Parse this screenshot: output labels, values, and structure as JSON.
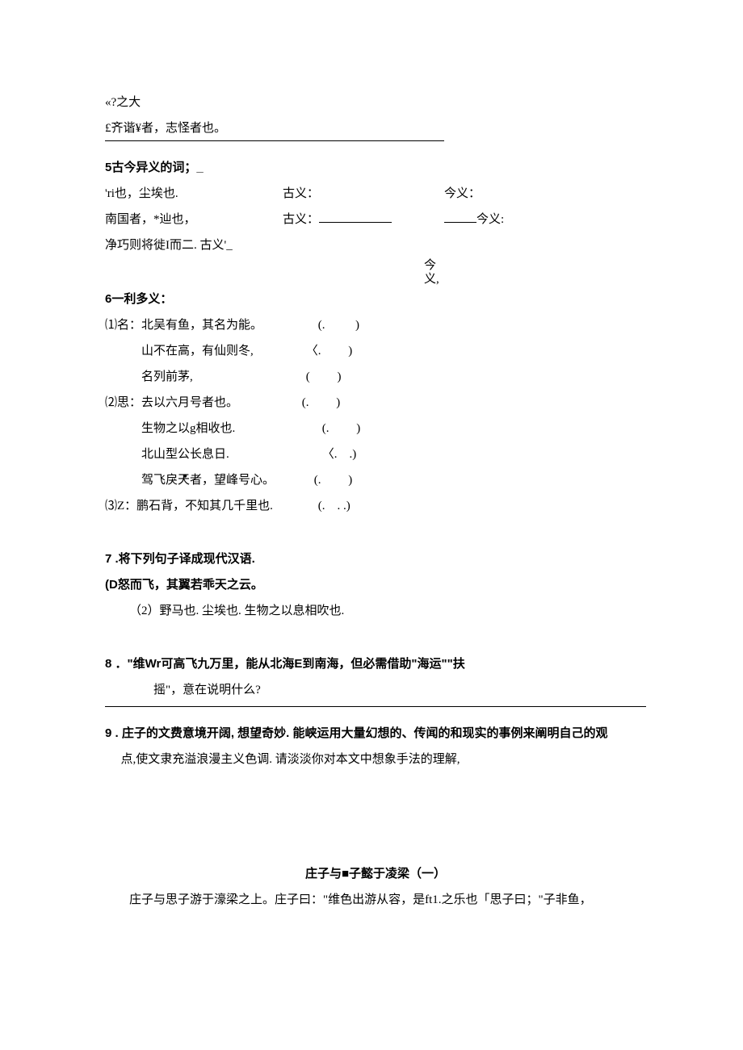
{
  "p01": "«?之大",
  "p02": "£齐谐¥者，志怪者也。",
  "q5": {
    "head": "5古今异义的词；_",
    "r1a": "'ri也，尘埃也.",
    "r1b": "古义：",
    "r1c": "今义：",
    "r2a": "南国者，*辿也，",
    "r2b": "古义：",
    "r2c": "今义:",
    "r3a": "净巧则将徙I而二. 古义'_",
    "jin1": "今",
    "jin2": "义,"
  },
  "q6": {
    "head": "6一利多义：",
    "n1": "⑴名：北吴有鱼，其名为能。",
    "n2": "山不在高，有仙则冬,",
    "n3": "名列前茅,",
    "s1": "⑵思：去以六月号者也。",
    "s2": "生物之以g相收也.",
    "s3": "北山型公长息日.",
    "s4": "驾飞戾天者，望峰号心。",
    "z1": "⑶Z：鹏石背，不知其几千里也."
  },
  "q7": {
    "head": "7 .将下列句子译成现代汉语.",
    "a": "(D怒而飞，其翼若乖天之云。",
    "b": "（2）野马也. 尘埃也. 生物之以息相吹也."
  },
  "q8": {
    "a": "8 ．\"维Wr可高飞九万里，能从北海E到南海，但必需借助\"海运\"\"扶",
    "b": "摇\"，意在说明什么?"
  },
  "q9": {
    "a": "9 . 庄子的文费意境开阔, 想望奇妙. 能峡运用大量幻想的、传闻的和现实的事例来阐明自己的观",
    "b": "点,使文隶充溢浪漫主义色调. 请淡淡你对本文中想象手法的理解,"
  },
  "foot": {
    "title": "庄子与■子懿于凌梁（一）",
    "p": "庄子与思子游于濠梁之上。庄子曰：\"维色出游从容，是ft1.之乐也「思子曰；\"子非鱼，"
  }
}
